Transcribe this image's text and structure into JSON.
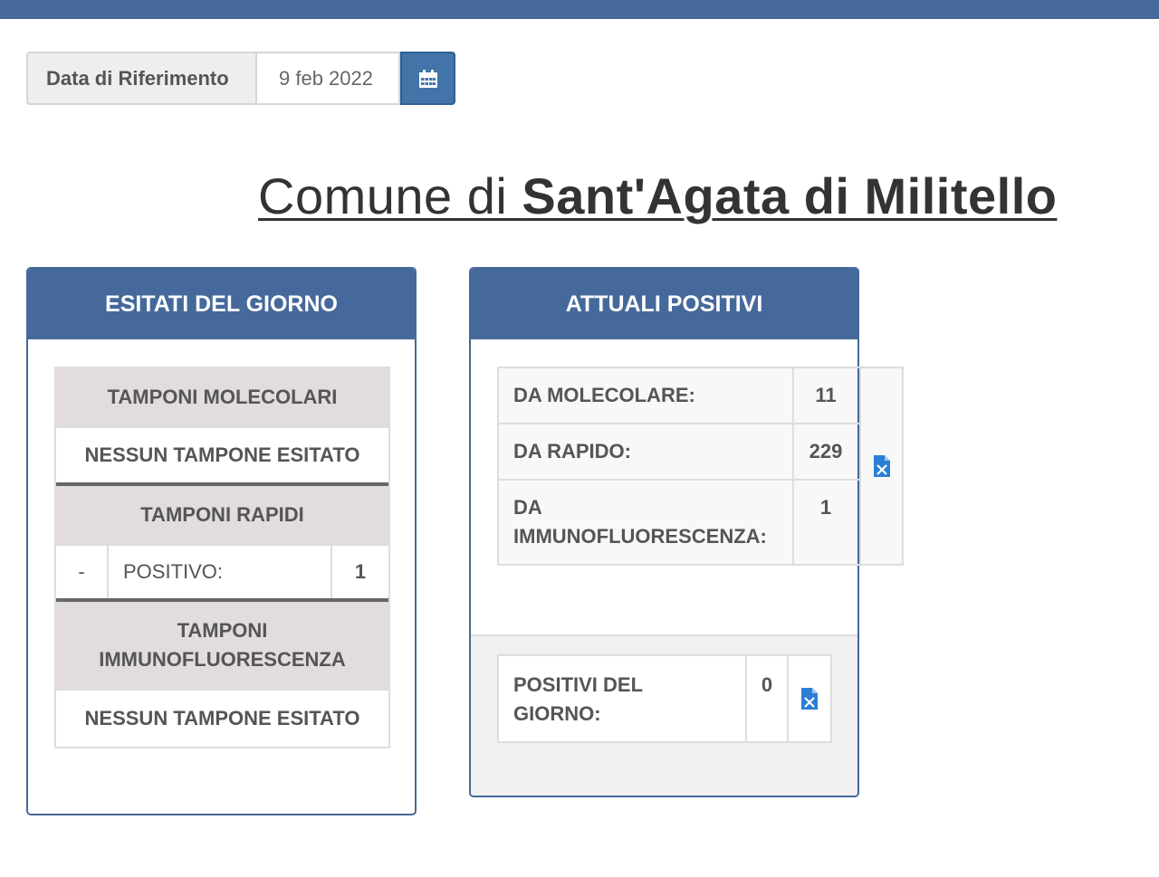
{
  "header": {
    "bar_color": "#45699a"
  },
  "date_picker": {
    "label": "Data di Riferimento",
    "value": "9 feb 2022",
    "button_icon": "calendar-icon"
  },
  "page_title": {
    "prefix": "Comune di ",
    "name": "Sant'Agata di Militello"
  },
  "esitati": {
    "title": "ESITATI DEL GIORNO",
    "molecolari": {
      "header": "TAMPONI MOLECOLARI",
      "empty": "NESSUN TAMPONE ESITATO"
    },
    "rapidi": {
      "header": "TAMPONI RAPIDI",
      "row": {
        "dash": "-",
        "label": "POSITIVO:",
        "value": "1"
      }
    },
    "immuno": {
      "header": "TAMPONI IMMUNOFLUORESCENZA",
      "empty": "NESSUN TAMPONE ESITATO"
    }
  },
  "attuali": {
    "title": "ATTUALI POSITIVI",
    "rows": [
      {
        "label": "DA MOLECOLARE:",
        "value": "11"
      },
      {
        "label": "DA RAPIDO:",
        "value": "229"
      },
      {
        "label": "DA IMMUNOFLUORESCENZA:",
        "value": "1"
      }
    ],
    "export_icon": "excel-file-icon",
    "positivi_giorno": {
      "label": "POSITIVI DEL GIORNO:",
      "value": "0",
      "export_icon": "excel-file-icon"
    }
  },
  "colors": {
    "accent": "#45699a",
    "button": "#4273a9",
    "table_header_bg": "#e2dcdc",
    "excel_icon": "#2b7fd6"
  }
}
